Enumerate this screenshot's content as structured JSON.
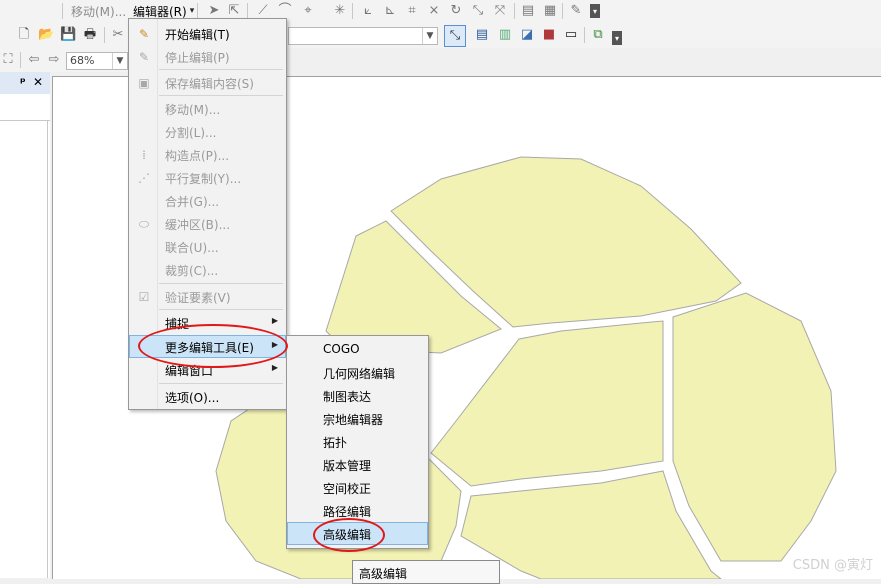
{
  "toolbar_top": {
    "move_label": "移动(M)...",
    "editor_label": "编辑器(R)"
  },
  "toolbar_second": {
    "icons": [
      "new-icon",
      "open-icon",
      "save-icon",
      "print-icon",
      "cut-icon"
    ]
  },
  "toolbar_third": {
    "zoom_value": "68%"
  },
  "panel": {
    "pin_glyph": "ᵖ",
    "close_glyph": "✕"
  },
  "menu": {
    "items": [
      {
        "label": "开始编辑(T)",
        "enabled": true,
        "icon": "pencil-icon"
      },
      {
        "label": "停止编辑(P)",
        "enabled": false,
        "icon": "pencil-stop-icon"
      },
      {
        "label": "保存编辑内容(S)",
        "enabled": false,
        "icon": "save-edits-icon"
      },
      {
        "label": "移动(M)...",
        "enabled": false
      },
      {
        "label": "分割(L)...",
        "enabled": false
      },
      {
        "label": "构造点(P)...",
        "enabled": false,
        "icon": "construct-points-icon"
      },
      {
        "label": "平行复制(Y)...",
        "enabled": false,
        "icon": "copy-parallel-icon"
      },
      {
        "label": "合并(G)...",
        "enabled": false
      },
      {
        "label": "缓冲区(B)...",
        "enabled": false,
        "icon": "buffer-icon"
      },
      {
        "label": "联合(U)...",
        "enabled": false
      },
      {
        "label": "裁剪(C)...",
        "enabled": false
      },
      {
        "label": "验证要素(V)",
        "enabled": false,
        "icon": "validate-icon"
      },
      {
        "label": "捕捉",
        "enabled": true,
        "submenu": true
      },
      {
        "label": "更多编辑工具(E)",
        "enabled": true,
        "submenu": true,
        "highlighted": true
      },
      {
        "label": "编辑窗口",
        "enabled": true,
        "submenu": true
      },
      {
        "label": "选项(O)...",
        "enabled": true
      }
    ]
  },
  "submenu": {
    "items": [
      {
        "label": "COGO"
      },
      {
        "label": "几何网络编辑"
      },
      {
        "label": "制图表达"
      },
      {
        "label": "宗地编辑器"
      },
      {
        "label": "拓扑"
      },
      {
        "label": "版本管理"
      },
      {
        "label": "空间校正"
      },
      {
        "label": "路径编辑"
      },
      {
        "label": "高级编辑",
        "highlighted": true
      }
    ]
  },
  "tooltip": "高级编辑",
  "watermark": "CSDN @寅灯",
  "colors": {
    "parcel_fill": "#f2f2b4",
    "parcel_stroke": "#a8a8a8",
    "highlight": "#cce4f7",
    "annotation": "#e01818"
  }
}
